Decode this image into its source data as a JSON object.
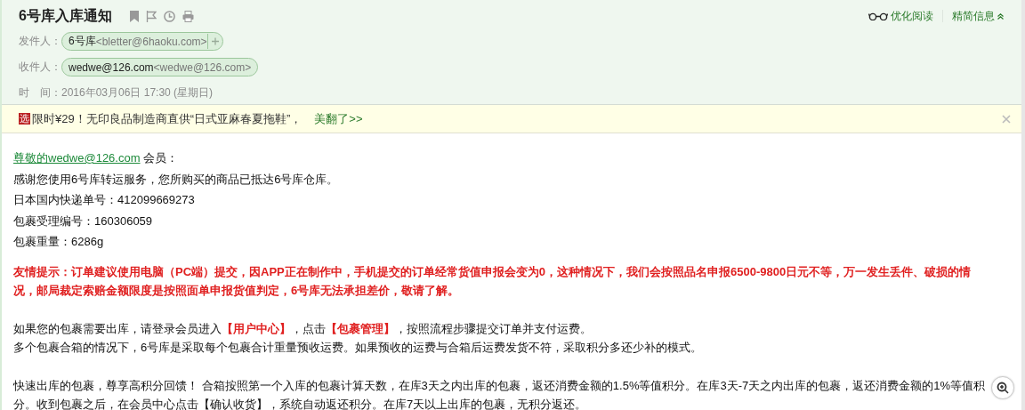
{
  "subject": "6号库入库通知",
  "header_links": [
    {
      "kind": "read",
      "label": "优化阅读"
    },
    {
      "kind": "collapse",
      "label": "精简信息"
    }
  ],
  "fields": [
    {
      "kind": "sender",
      "label": "发件人：",
      "name": "6号库",
      "address": "<bletter@6haoku.com>"
    },
    {
      "kind": "recipient",
      "label": "收件人：",
      "name": "wedwe@126.com",
      "address": "<wedwe@126.com>"
    },
    {
      "kind": "time",
      "label": "时　间：",
      "value": "2016年03月06日 17:30 (星期日)"
    }
  ],
  "ad": {
    "badge": "选",
    "text": "限时¥29！无印良品制造商直供“日式亚麻春夏拖鞋”，",
    "link": "美翻了>>"
  },
  "body": {
    "greeting_link": "尊敬的wedwe@126.com",
    "greeting_rest": " 会员：",
    "lines": [
      "感谢您使用6号库转运服务，您所购买的商品已抵达6号库仓库。",
      "日本国内快递单号：412099669273",
      "包裹受理编号：160306059",
      "包裹重量：6286g"
    ],
    "notice": "友情提示：订单建议使用电脑（PC端）提交，因APP正在制作中，手机提交的订单经常货值申报会变为0，这种情况下，我们会按照品名申报6500-9800日元不等，万一发生丢件、破损的情况，邮局裁定索赔金额限度是按照面单申报货值判定，6号库无法承担差价，敬请了解。",
    "paragraphs": [
      [
        {
          "kind": "text",
          "text": "如果您的包裹需要出库，请登录会员进入"
        },
        {
          "kind": "highlight",
          "text": "【用户中心】"
        },
        {
          "kind": "text",
          "text": "，点击"
        },
        {
          "kind": "highlight",
          "text": "【包裹管理】"
        },
        {
          "kind": "text",
          "text": "，按照流程步骤提交订单并支付运费。"
        }
      ],
      [
        {
          "kind": "text",
          "text": "多个包裹合箱的情况下，6号库是采取每个包裹合计重量预收运费。如果预收的运费与合箱后运费发货不符，采取积分多还少补的模式。"
        }
      ],
      [
        {
          "kind": "gap"
        }
      ],
      [
        {
          "kind": "text",
          "text": "快速出库的包裹，尊享高积分回馈！ 合箱按照第一个入库的包裹计算天数，在库3天之内出库的包裹，返还消费金额的1.5%等值积分。在库3天-7天之内出库的包裹，返还消费金额的1%等值积分。收到包裹之后，在会员中心点击【确认收货】，系统自动返还积分。在库7天以上出库的包裹，无积分返还。"
        }
      ]
    ]
  }
}
